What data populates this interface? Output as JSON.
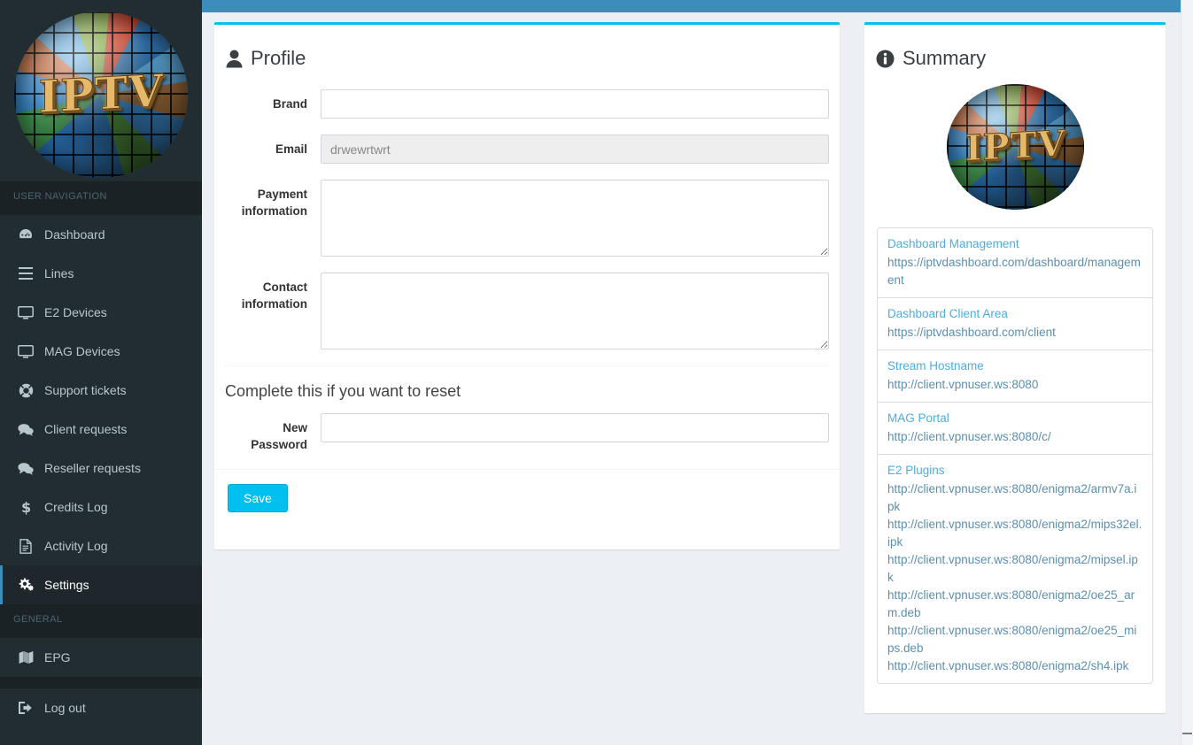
{
  "theme": {
    "topbar_color": "#3c8dbc",
    "sidebar_color": "#222d32",
    "accent_color": "#00c0ef",
    "active_border_color": "#3c8dbc",
    "link_color": "#4eaddf",
    "page_background": "#eceff3"
  },
  "brand": {
    "logo_text": "IPTV",
    "logo_alt": "iptv-globe-logo"
  },
  "sidebar": {
    "sections": [
      {
        "header": "USER NAVIGATION",
        "items": [
          {
            "label": "Dashboard",
            "icon": "dashboard-icon",
            "active": false
          },
          {
            "label": "Lines",
            "icon": "bars-icon",
            "active": false
          },
          {
            "label": "E2 Devices",
            "icon": "desktop-icon",
            "active": false
          },
          {
            "label": "MAG Devices",
            "icon": "desktop-icon",
            "active": false
          },
          {
            "label": "Support tickets",
            "icon": "lifering-icon",
            "active": false
          },
          {
            "label": "Client requests",
            "icon": "comments-icon",
            "active": false
          },
          {
            "label": "Reseller requests",
            "icon": "comments-icon",
            "active": false
          },
          {
            "label": "Credits Log",
            "icon": "dollar-icon",
            "active": false
          },
          {
            "label": "Activity Log",
            "icon": "file-icon",
            "active": false
          },
          {
            "label": "Settings",
            "icon": "cogs-icon",
            "active": true
          }
        ]
      },
      {
        "header": "GENERAL",
        "items": [
          {
            "label": "EPG",
            "icon": "map-icon",
            "active": false
          }
        ]
      },
      {
        "header": "",
        "items": [
          {
            "label": "Log out",
            "icon": "signout-icon",
            "active": false
          }
        ]
      }
    ]
  },
  "profile": {
    "title": "Profile",
    "title_icon": "user-icon",
    "fields": {
      "brand": {
        "label": "Brand",
        "value": "",
        "placeholder": "",
        "disabled": false
      },
      "email": {
        "label": "Email",
        "value": "drwewrtwrt",
        "placeholder": "",
        "disabled": true
      },
      "payment_information": {
        "label": "Payment information",
        "value": "",
        "placeholder": "",
        "disabled": false
      },
      "contact_information": {
        "label": "Contact information",
        "value": "",
        "placeholder": "",
        "disabled": false
      },
      "new_password": {
        "label": "New Password",
        "value": "",
        "placeholder": "",
        "disabled": false
      }
    },
    "reset_heading": "Complete this if you want to reset",
    "save_label": "Save"
  },
  "summary": {
    "title": "Summary",
    "title_icon": "info-circle-icon",
    "items": [
      {
        "title": "Dashboard Management",
        "urls": [
          "https://iptvdashboard.com/dashboard/management"
        ]
      },
      {
        "title": "Dashboard Client Area",
        "urls": [
          "https://iptvdashboard.com/client"
        ]
      },
      {
        "title": "Stream Hostname",
        "urls": [
          "http://client.vpnuser.ws:8080"
        ]
      },
      {
        "title": "MAG Portal",
        "urls": [
          "http://client.vpnuser.ws:8080/c/"
        ]
      },
      {
        "title": "E2 Plugins",
        "urls": [
          "http://client.vpnuser.ws:8080/enigma2/armv7a.ipk",
          "http://client.vpnuser.ws:8080/enigma2/mips32el.ipk",
          "http://client.vpnuser.ws:8080/enigma2/mipsel.ipk",
          "http://client.vpnuser.ws:8080/enigma2/oe25_arm.deb",
          "http://client.vpnuser.ws:8080/enigma2/oe25_mips.deb",
          "http://client.vpnuser.ws:8080/enigma2/sh4.ipk"
        ]
      }
    ]
  }
}
